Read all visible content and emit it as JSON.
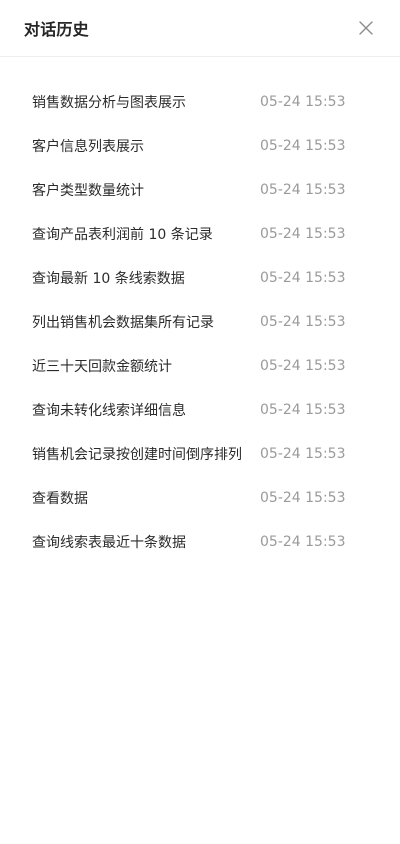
{
  "header": {
    "title": "对话历史",
    "close_icon": "close-icon"
  },
  "history": [
    {
      "title": "销售数据分析与图表展示",
      "time": "05-24 15:53"
    },
    {
      "title": "客户信息列表展示",
      "time": "05-24 15:53"
    },
    {
      "title": "客户类型数量统计",
      "time": "05-24 15:53"
    },
    {
      "title": "查询产品表利润前 10 条记录",
      "time": "05-24 15:53"
    },
    {
      "title": "查询最新 10 条线索数据",
      "time": "05-24 15:53"
    },
    {
      "title": "列出销售机会数据集所有记录",
      "time": "05-24 15:53"
    },
    {
      "title": "近三十天回款金额统计",
      "time": "05-24 15:53"
    },
    {
      "title": "查询未转化线索详细信息",
      "time": "05-24 15:53"
    },
    {
      "title": "销售机会记录按创建时间倒序排列",
      "time": "05-24 15:53"
    },
    {
      "title": "查看数据",
      "time": "05-24 15:53"
    },
    {
      "title": "查询线索表最近十条数据",
      "time": "05-24 15:53"
    }
  ],
  "colors": {
    "title": "#262626",
    "item_text": "#2b2b2b",
    "time_text": "#9a9a9a",
    "divider": "#eeeeee"
  }
}
